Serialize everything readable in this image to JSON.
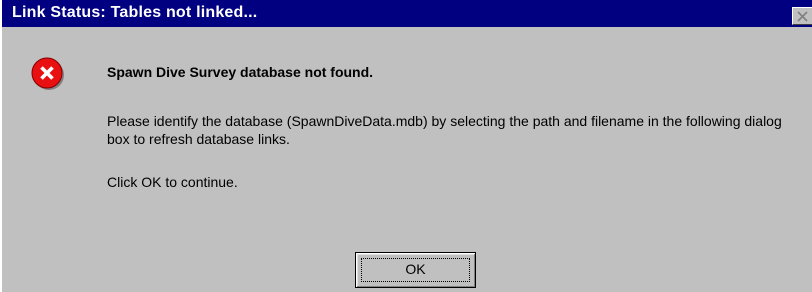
{
  "window": {
    "title": "Link Status: Tables not linked..."
  },
  "message": {
    "icon": "error-icon",
    "heading": "Spawn Dive Survey database not found.",
    "body": "Please identify the database (SpawnDiveData.mdb) by selecting the path and filename in the following dialog box to refresh database links.",
    "instruction": "Click OK to continue."
  },
  "buttons": {
    "ok_label": "OK"
  },
  "colors": {
    "titlebar": "#000080",
    "dialog_background": "#c0c0c0",
    "error_red": "#e81010"
  }
}
